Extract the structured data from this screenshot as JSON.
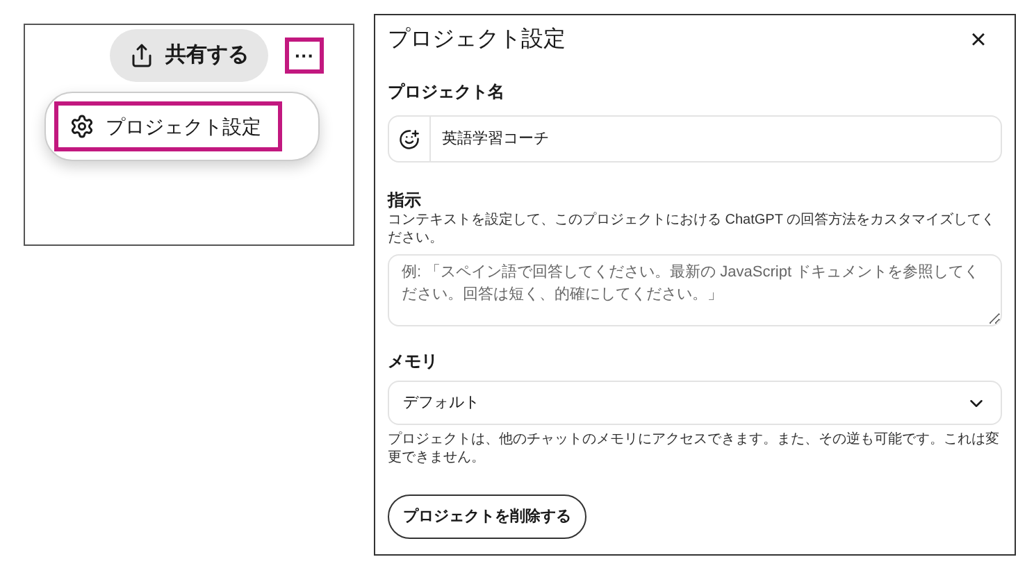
{
  "menu_demo": {
    "share_button": "共有する",
    "more_button": {
      "label": "···",
      "highlighted": true
    },
    "menu_items": [
      {
        "label": "プロジェクト設定",
        "highlighted": true
      }
    ]
  },
  "dialog": {
    "title": "プロジェクト設定",
    "close": "×",
    "name_section": {
      "label": "プロジェクト名",
      "value": "英語学習コーチ"
    },
    "instructions_section": {
      "label": "指示",
      "description": "コンテキストを設定して、このプロジェクトにおける ChatGPT の回答方法をカスタマイズしてください。",
      "placeholder": "例: 「スペイン語で回答してください。最新の JavaScript ドキュメントを参照してください。回答は短く、的確にしてください。」"
    },
    "memory_section": {
      "label": "メモリ",
      "value": "デフォルト",
      "note": "プロジェクトは、他のチャットのメモリにアクセスできます。また、その逆も可能です。これは変更できません。"
    },
    "delete_button": "プロジェクトを削除する"
  }
}
